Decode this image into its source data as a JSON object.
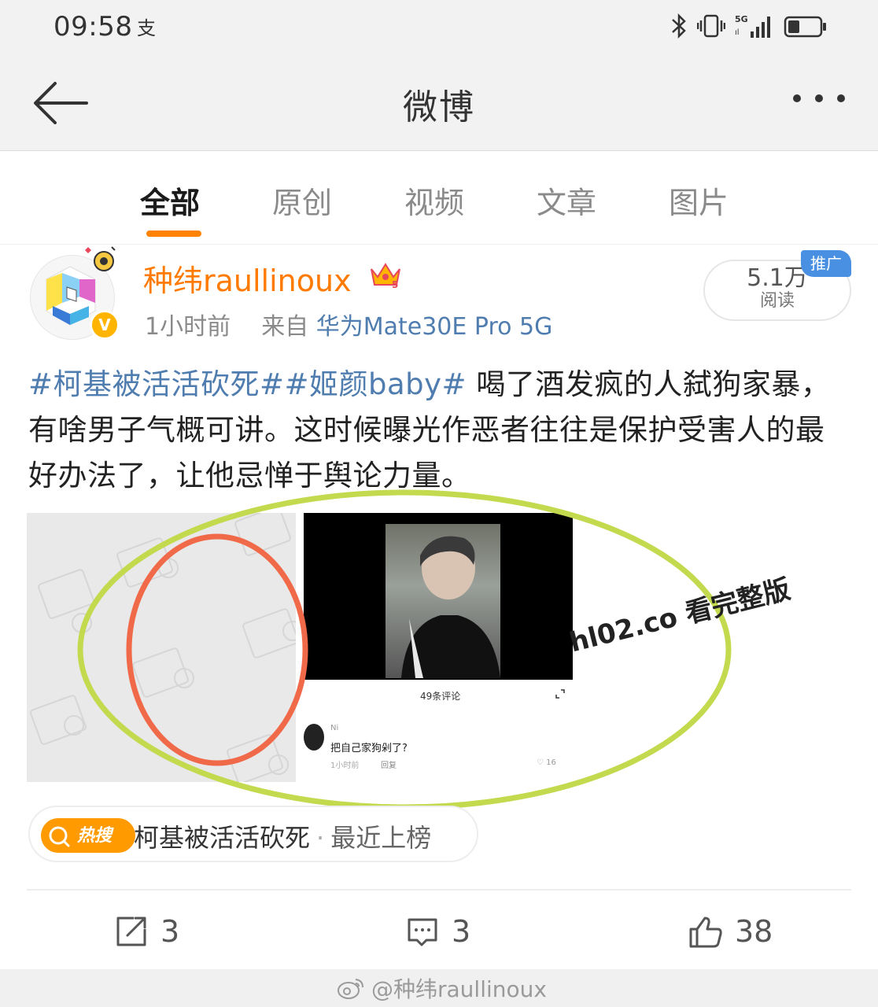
{
  "status_bar": {
    "time": "09:58",
    "network": "5G"
  },
  "nav": {
    "title": "微博"
  },
  "tabs": [
    {
      "label": "全部",
      "active": true
    },
    {
      "label": "原创",
      "active": false
    },
    {
      "label": "视频",
      "active": false
    },
    {
      "label": "文章",
      "active": false
    },
    {
      "label": "图片",
      "active": false
    }
  ],
  "post": {
    "username": "种纬raullinoux",
    "time_ago": "1小时前",
    "source_prefix": "来自",
    "source": "华为Mate30E Pro 5G",
    "reads": "5.1万",
    "reads_label": "阅读",
    "promo_badge": "推广",
    "tag1": "#柯基被活活砍死#",
    "tag2": "#姬颜baby#",
    "body": " 喝了酒发疯的人弑狗家暴，有啥男子气概可讲。这时候曝光作恶者往往是保护受害人的最好办法了，让他忌惮于舆论力量。",
    "media": {
      "comment_count": "49条评论",
      "comment_user": "Ni",
      "comment_text": "把自己家狗剁了?",
      "comment_time": "1小时前",
      "comment_reply": "回复",
      "comment_likes": "16",
      "watermark": "hl02.co 看完整版"
    },
    "hot_search": {
      "badge": "热搜",
      "topic": "柯基被活活砍死",
      "separator": "·",
      "status": "最近上榜"
    },
    "actions": {
      "reposts": "3",
      "comments": "3",
      "likes": "38"
    }
  },
  "footer_watermark": "@种纬raullinoux",
  "colors": {
    "accent_orange": "#ff8200",
    "link_blue": "#507daf",
    "annotation_green": "#c3d94e",
    "annotation_red": "#f06a4a"
  }
}
